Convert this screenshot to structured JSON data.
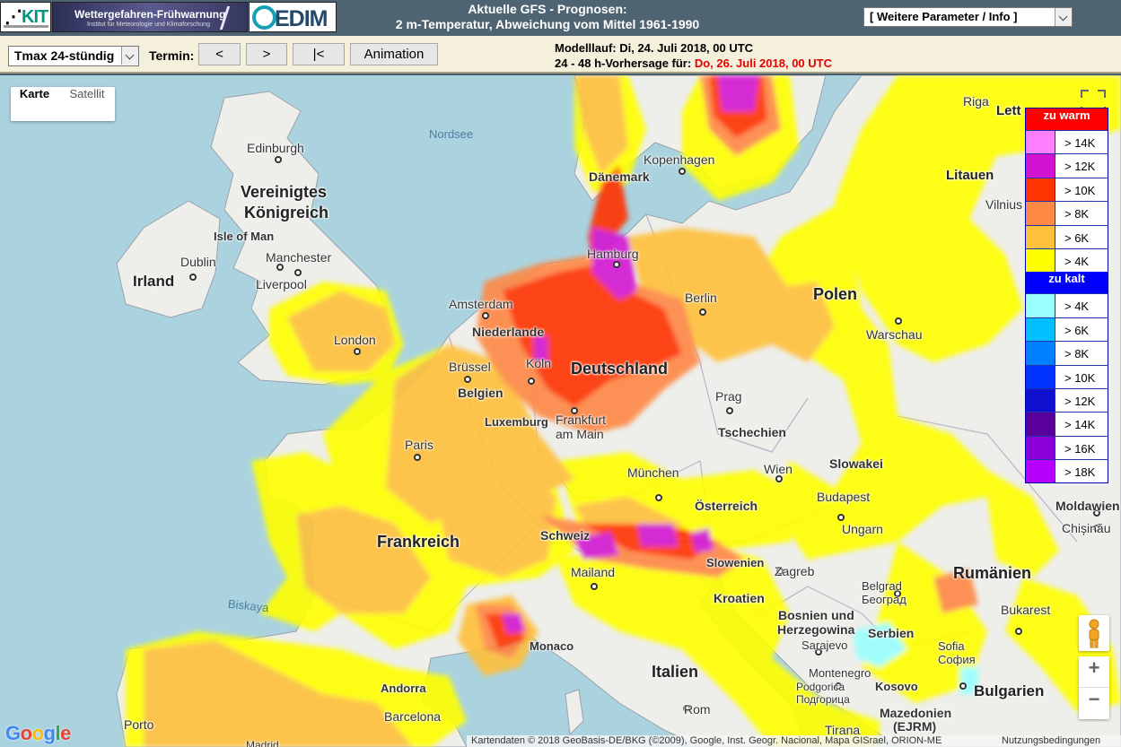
{
  "header": {
    "logo_kit": "KIT",
    "logo_warn": "Wettergefahren-Frühwarnung",
    "logo_warn_sub": "Institut für Meteorologie und Klimaforschung",
    "logo_cedim": "EDIM",
    "title_line1": "Aktuelle GFS - Prognosen:",
    "title_line2": "2 m-Temperatur, Abweichung vom Mittel 1961-1990",
    "param_select": "[ Weitere Parameter / Info ]"
  },
  "toolbar": {
    "product_select": "Tmax 24-stündig",
    "termin_label": "Termin:",
    "btn_prev": "<",
    "btn_next": ">",
    "btn_first": "|<",
    "btn_animation": "Animation",
    "model_run": "Modelllauf: Di, 24. Juli 2018, 00 UTC",
    "forecast_prefix": "24 - 48 h-Vorhersage für: ",
    "forecast_date": "Do, 26. Juli 2018, 00 UTC"
  },
  "map": {
    "type_karte": "Karte",
    "type_satellit": "Satellit",
    "zoom_in": "+",
    "zoom_out": "−",
    "google": "Google",
    "attribution": "Kartendaten © 2018 GeoBasis-DE/BKG (©2009), Google, Inst. Geogr. Nacional, Mapa GISrael, ORION-ME",
    "terms": "Nutzungsbedingungen",
    "labels": {
      "nordsee": "Nordsee",
      "biskaya": "Biskaya",
      "vk1": "Vereinigtes",
      "vk2": "Königreich",
      "irland": "Irland",
      "polen": "Polen",
      "deutschland": "Deutschland",
      "frankreich": "Frankreich",
      "italien": "Italien",
      "rumaenien": "Rumänien",
      "litauen": "Litauen",
      "lettland": "Lett",
      "tschechien": "Tschechien",
      "slowakei": "Slowakei",
      "oesterreich": "Österreich",
      "schweiz": "Schweiz",
      "slowenien": "Slowenien",
      "kroatien": "Kroatien",
      "bosnien1": "Bosnien und",
      "bosnien2": "Herzegowina",
      "serbien": "Serbien",
      "montenegro": "Montenegro",
      "kosovo": "Kosovo",
      "bulgarien": "Bulgarien",
      "mazedonien1": "Mazedonien",
      "mazedonien2": "(EJRM)",
      "moldawien": "Moldawien",
      "ungarn": "Ungarn",
      "belgien": "Belgien",
      "luxemburg": "Luxemburg",
      "niederlande": "Niederlande",
      "daenemark": "Dänemark",
      "andorra": "Andorra",
      "monaco": "Monaco",
      "edinburgh": "Edinburgh",
      "isle_of_man": "Isle of Man",
      "dublin": "Dublin",
      "manchester": "Manchester",
      "liverpool": "Liverpool",
      "london": "London",
      "amsterdam": "Amsterdam",
      "bruessel": "Brüssel",
      "koeln": "Köln",
      "hamburg": "Hamburg",
      "berlin": "Berlin",
      "kopenhagen": "Kopenhagen",
      "warschau": "Warschau",
      "prag": "Prag",
      "frankfurt1": "Frankfurt",
      "frankfurt2": "am Main",
      "paris": "Paris",
      "muenchen": "München",
      "wien": "Wien",
      "budapest": "Budapest",
      "zagreb": "Zagreb",
      "mailand": "Mailand",
      "belgrad1": "Belgrad",
      "belgrad2": "Београд",
      "bukarest": "Bukarest",
      "sarajevo": "Sarajevo",
      "podgorica1": "Podgorica",
      "podgorica2": "Подгорица",
      "sofia1": "Sofia",
      "sofia2": "София",
      "rom": "Rom",
      "barcelona": "Barcelona",
      "porto": "Porto",
      "tirana": "Tirana",
      "riga": "Riga",
      "vilnius": "Vilnius",
      "chisinau": "Chișinău",
      "madrid": "Madrid"
    }
  },
  "legend": {
    "warm_header": "zu warm",
    "cold_header": "zu kalt",
    "warm_color": "#ff0000",
    "cold_color": "#0000ff",
    "warm": [
      {
        "label": "> 14K",
        "color": "#ff80ff"
      },
      {
        "label": "> 12K",
        "color": "#d214d2"
      },
      {
        "label": "> 10K",
        "color": "#ff3300"
      },
      {
        "label": "> 8K",
        "color": "#ff8844"
      },
      {
        "label": "> 6K",
        "color": "#ffc03a"
      },
      {
        "label": "> 4K",
        "color": "#ffff00"
      }
    ],
    "cold": [
      {
        "label": "> 4K",
        "color": "#99ffff"
      },
      {
        "label": "> 6K",
        "color": "#00c0ff"
      },
      {
        "label": "> 8K",
        "color": "#0080ff"
      },
      {
        "label": "> 10K",
        "color": "#0033ff"
      },
      {
        "label": "> 12K",
        "color": "#1010d0"
      },
      {
        "label": "> 14K",
        "color": "#5a009a"
      },
      {
        "label": "> 16K",
        "color": "#8b00d6"
      },
      {
        "label": "> 18K",
        "color": "#b800ff"
      }
    ]
  }
}
